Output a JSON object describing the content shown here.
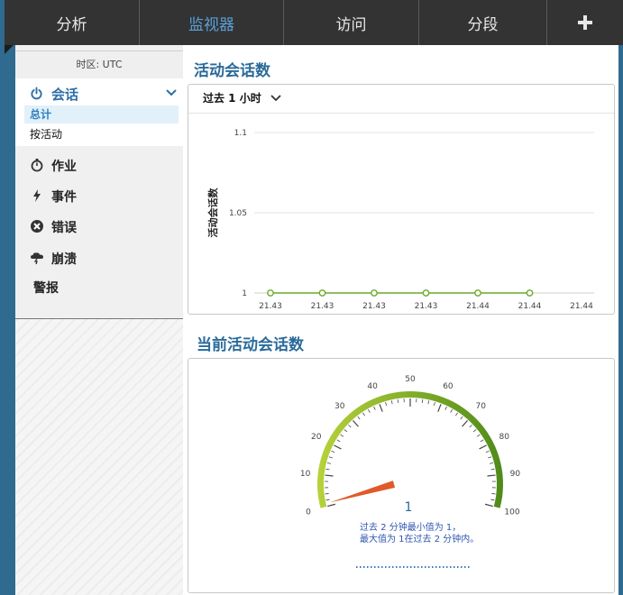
{
  "topnav": {
    "tabs": [
      {
        "label": "分析",
        "active": false
      },
      {
        "label": "监视器",
        "active": true
      },
      {
        "label": "访问",
        "active": false
      },
      {
        "label": "分段",
        "active": false
      }
    ],
    "add_icon": "plus-icon"
  },
  "sidebar": {
    "timezone": "时区: UTC",
    "session": {
      "label": "会话",
      "icon": "power-icon",
      "subitems": [
        {
          "label": "总计",
          "active": true
        },
        {
          "label": "按活动",
          "active": false
        }
      ]
    },
    "items": [
      {
        "label": "作业",
        "icon": "stopwatch-icon"
      },
      {
        "label": "事件",
        "icon": "lightning-icon"
      },
      {
        "label": "错误",
        "icon": "error-circle-icon"
      },
      {
        "label": "崩溃",
        "icon": "storm-cloud-icon"
      },
      {
        "label": "警报",
        "icon": ""
      }
    ]
  },
  "main": {
    "active_sessions_title": "活动会话数",
    "time_range": "过去 1 小时",
    "current_sessions_title": "当前活动会话数"
  },
  "chart_data": [
    {
      "type": "line",
      "ylabel": "活动会话数",
      "y_ticks": [
        "1.1",
        "1.05",
        "1"
      ],
      "ylim": [
        1,
        1.1
      ],
      "x_tick_labels": [
        "21.43",
        "21.43",
        "21.43",
        "21.43",
        "21.44",
        "21.44",
        "21.44"
      ],
      "series": [
        {
          "values": [
            1,
            1,
            1,
            1,
            1,
            1
          ]
        }
      ],
      "color": "#6aaa2a",
      "grid": true
    },
    {
      "type": "gauge",
      "value": 1,
      "min": 0,
      "max": 100,
      "major_ticks": [
        "0",
        "10",
        "20",
        "30",
        "40",
        "50",
        "60",
        "70",
        "80",
        "90",
        "100"
      ],
      "value_label": "1",
      "caption_line1": "过去 2 分钟最小值为 1，",
      "caption_line2": "最大值为 1在过去 2 分钟内。",
      "needle_color": "#e05a2a",
      "arc_colors": [
        "#b7d23a",
        "#4f8a1a"
      ]
    }
  ]
}
